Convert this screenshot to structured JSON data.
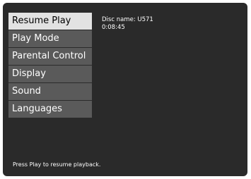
{
  "menu": {
    "items": [
      {
        "label": "Resume Play",
        "selected": true
      },
      {
        "label": "Play Mode",
        "selected": false
      },
      {
        "label": "Parental Control",
        "selected": false
      },
      {
        "label": "Display",
        "selected": false
      },
      {
        "label": "Sound",
        "selected": false
      },
      {
        "label": "Languages",
        "selected": false
      }
    ]
  },
  "info": {
    "disc_name": "Disc name: U571",
    "time": "0:08:45"
  },
  "footer": {
    "hint": "Press Play to resume playback."
  },
  "colors": {
    "screen_bg": "#2a2a2a",
    "menu_item_bg": "#5a5a5a",
    "menu_item_selected_bg": "#e2e2e2",
    "text": "#ffffff"
  }
}
